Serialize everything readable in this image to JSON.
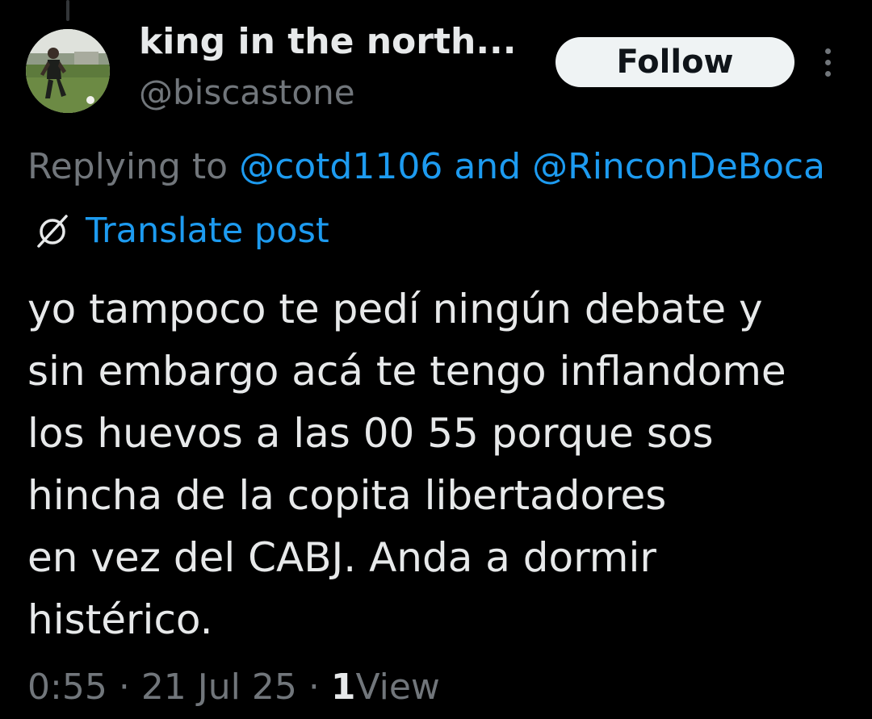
{
  "author": {
    "display_name": "king in the north...",
    "handle": "@biscastone",
    "avatar_icon": "football-player-avatar"
  },
  "follow_label": "Follow",
  "more_icon": "more-vertical-icon",
  "reply": {
    "prefix": "Replying to",
    "mention_1": "@cotd1106",
    "joiner": "and",
    "mention_2": "@RinconDeBoca"
  },
  "translate": {
    "icon": "translate-globe-icon",
    "label": "Translate post"
  },
  "tweet_lines": [
    "yo tampoco te pedí ningún debate y",
    "sin embargo acá te tengo inflandome",
    "los huevos a las 00 55 porque sos",
    "hincha de la copita libertadores",
    "en vez del CABJ. Anda a dormir",
    "histérico."
  ],
  "meta": {
    "time": "0:55",
    "separator": "·",
    "date": "21 Jul 25",
    "view_count": "1",
    "view_label": "View"
  },
  "colors": {
    "background": "#000000",
    "text_primary": "#e7e9ea",
    "text_secondary": "#71767b",
    "link_blue": "#1d9bf0",
    "follow_bg": "#eff3f4"
  }
}
